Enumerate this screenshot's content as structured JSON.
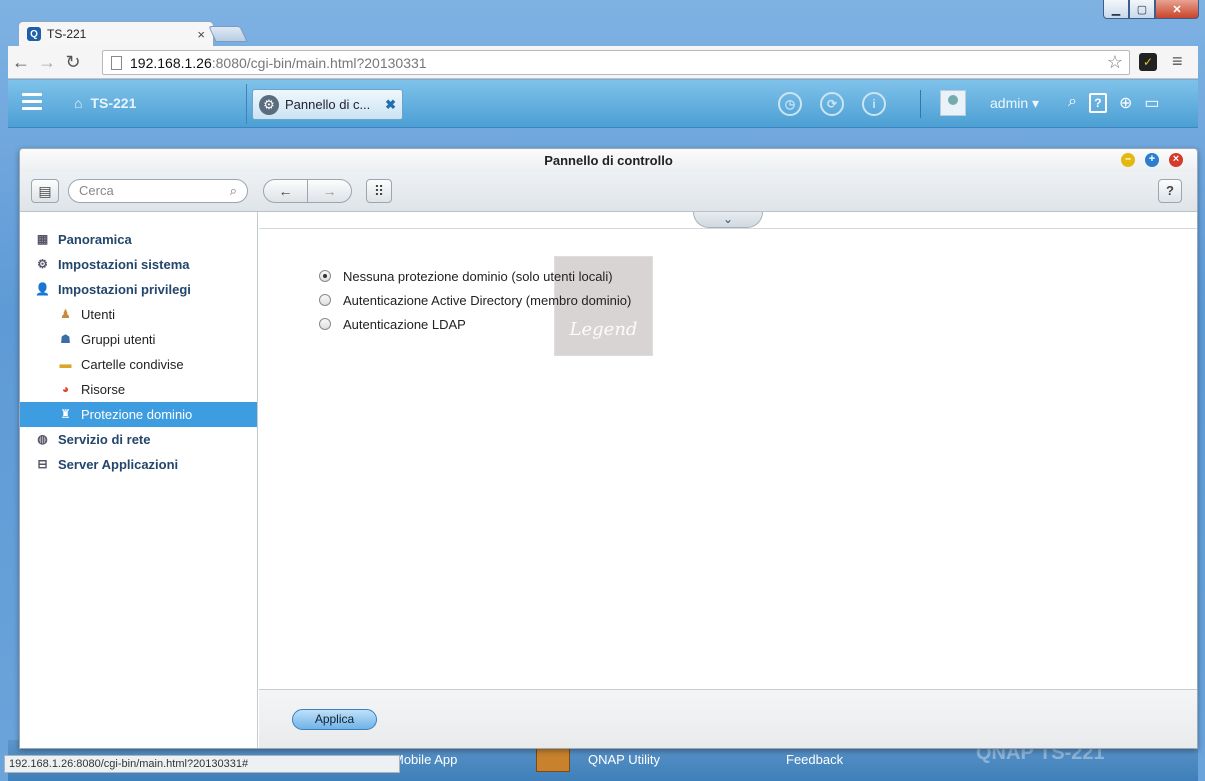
{
  "browser": {
    "tab_title": "TS-221",
    "tab_favicon": "Q",
    "url_host": "192.168.1.26",
    "url_path": ":8080/cgi-bin/main.html?20130331",
    "status_url": "192.168.1.26:8080/cgi-bin/main.html?20130331#"
  },
  "topbar": {
    "home_label": "TS-221",
    "app_tab_label": "Pannello di c...",
    "user": "admin"
  },
  "desktop": {
    "items": [
      "Mobile App",
      "QNAP Utility",
      "Feedback"
    ],
    "brand": "QNAP TS-221"
  },
  "window": {
    "title": "Pannello di controllo",
    "search_placeholder": "Cerca"
  },
  "sidebar": {
    "items": [
      {
        "label": "Panoramica",
        "icon": "grid-icon"
      },
      {
        "label": "Impostazioni sistema",
        "icon": "gear-icon"
      },
      {
        "label": "Impostazioni privilegi",
        "icon": "user-icon"
      },
      {
        "label": "Utenti",
        "icon": "single-user-icon"
      },
      {
        "label": "Gruppi utenti",
        "icon": "users-group-icon"
      },
      {
        "label": "Cartelle condivise",
        "icon": "folder-icon"
      },
      {
        "label": "Risorse",
        "icon": "quota-icon"
      },
      {
        "label": "Protezione dominio",
        "icon": "domain-security-icon"
      },
      {
        "label": "Servizio di rete",
        "icon": "globe-icon"
      },
      {
        "label": "Server Applicazioni",
        "icon": "server-icon"
      }
    ]
  },
  "main": {
    "options": [
      {
        "label": "Nessuna protezione dominio (solo utenti locali)",
        "checked": true
      },
      {
        "label": "Autenticazione Active Directory (membro dominio)",
        "checked": false
      },
      {
        "label": "Autenticazione LDAP",
        "checked": false
      }
    ],
    "watermark": "Legend",
    "apply_label": "Applica"
  },
  "colors": {
    "accent": "#3d9de0",
    "topbar": "#5aaade"
  }
}
